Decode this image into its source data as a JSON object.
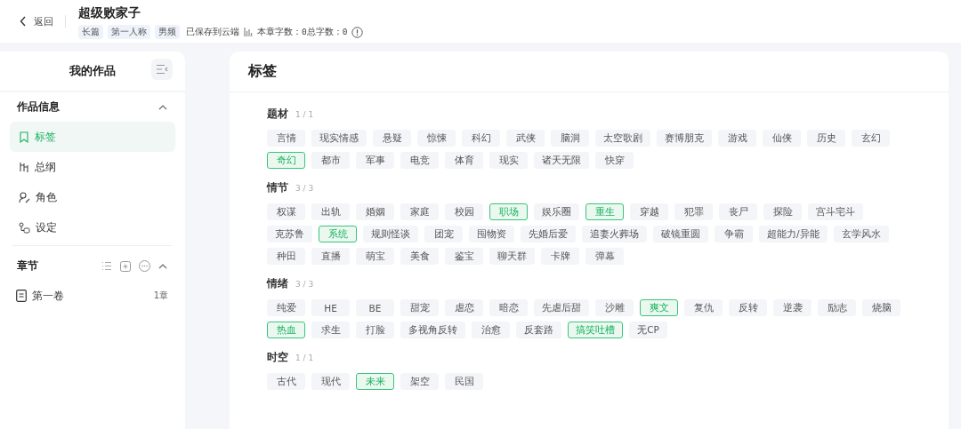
{
  "header": {
    "back_label": "返回",
    "title": "超级败家子",
    "chips": [
      "长篇",
      "第一人称",
      "男频"
    ],
    "save_status": "已保存到云端",
    "word_count": "本章字数：0总字数：0"
  },
  "sidebar": {
    "title": "我的作品",
    "sections": [
      {
        "title": "作品信息",
        "kind": "info",
        "expanded": true,
        "items": [
          {
            "label": "标签",
            "kind": "tag",
            "selected": true
          },
          {
            "label": "总纲",
            "kind": "outline",
            "selected": false
          },
          {
            "label": "角色",
            "kind": "character",
            "selected": false
          },
          {
            "label": "设定",
            "kind": "setting",
            "selected": false
          }
        ]
      },
      {
        "title": "章节",
        "kind": "chapters",
        "expanded": true,
        "items": [
          {
            "label": "第一卷",
            "kind": "volume",
            "selected": false,
            "count": "1章"
          }
        ]
      }
    ]
  },
  "main": {
    "title": "标签",
    "groups": [
      {
        "name": "题材",
        "count": "1 / 1",
        "tags": [
          {
            "label": "言情",
            "selected": false
          },
          {
            "label": "现实情感",
            "selected": false
          },
          {
            "label": "悬疑",
            "selected": false
          },
          {
            "label": "惊悚",
            "selected": false
          },
          {
            "label": "科幻",
            "selected": false
          },
          {
            "label": "武侠",
            "selected": false
          },
          {
            "label": "脑洞",
            "selected": false
          },
          {
            "label": "太空歌剧",
            "selected": false
          },
          {
            "label": "赛博朋克",
            "selected": false
          },
          {
            "label": "游戏",
            "selected": false
          },
          {
            "label": "仙侠",
            "selected": false
          },
          {
            "label": "历史",
            "selected": false
          },
          {
            "label": "玄幻",
            "selected": false
          },
          {
            "label": "奇幻",
            "selected": true
          },
          {
            "label": "都市",
            "selected": false
          },
          {
            "label": "军事",
            "selected": false
          },
          {
            "label": "电竞",
            "selected": false
          },
          {
            "label": "体育",
            "selected": false
          },
          {
            "label": "现实",
            "selected": false
          },
          {
            "label": "诸天无限",
            "selected": false
          },
          {
            "label": "快穿",
            "selected": false
          }
        ]
      },
      {
        "name": "情节",
        "count": "3 / 3",
        "tags": [
          {
            "label": "权谋",
            "selected": false
          },
          {
            "label": "出轨",
            "selected": false
          },
          {
            "label": "婚姻",
            "selected": false
          },
          {
            "label": "家庭",
            "selected": false
          },
          {
            "label": "校园",
            "selected": false
          },
          {
            "label": "职场",
            "selected": true
          },
          {
            "label": "娱乐圈",
            "selected": false
          },
          {
            "label": "重生",
            "selected": true
          },
          {
            "label": "穿越",
            "selected": false
          },
          {
            "label": "犯罪",
            "selected": false
          },
          {
            "label": "丧尸",
            "selected": false
          },
          {
            "label": "探险",
            "selected": false
          },
          {
            "label": "宫斗宅斗",
            "selected": false
          },
          {
            "label": "克苏鲁",
            "selected": false
          },
          {
            "label": "系统",
            "selected": true
          },
          {
            "label": "规则怪谈",
            "selected": false
          },
          {
            "label": "团宠",
            "selected": false
          },
          {
            "label": "囤物资",
            "selected": false
          },
          {
            "label": "先婚后爱",
            "selected": false
          },
          {
            "label": "追妻火葬场",
            "selected": false
          },
          {
            "label": "破镜重圆",
            "selected": false
          },
          {
            "label": "争霸",
            "selected": false
          },
          {
            "label": "超能力/异能",
            "selected": false
          },
          {
            "label": "玄学风水",
            "selected": false
          },
          {
            "label": "种田",
            "selected": false
          },
          {
            "label": "直播",
            "selected": false
          },
          {
            "label": "萌宝",
            "selected": false
          },
          {
            "label": "美食",
            "selected": false
          },
          {
            "label": "鉴宝",
            "selected": false
          },
          {
            "label": "聊天群",
            "selected": false
          },
          {
            "label": "卡牌",
            "selected": false
          },
          {
            "label": "弹幕",
            "selected": false
          }
        ]
      },
      {
        "name": "情绪",
        "count": "3 / 3",
        "tags": [
          {
            "label": "纯爱",
            "selected": false
          },
          {
            "label": "HE",
            "selected": false
          },
          {
            "label": "BE",
            "selected": false
          },
          {
            "label": "甜宠",
            "selected": false
          },
          {
            "label": "虐恋",
            "selected": false
          },
          {
            "label": "暗恋",
            "selected": false
          },
          {
            "label": "先虐后甜",
            "selected": false
          },
          {
            "label": "沙雕",
            "selected": false
          },
          {
            "label": "爽文",
            "selected": true
          },
          {
            "label": "复仇",
            "selected": false
          },
          {
            "label": "反转",
            "selected": false
          },
          {
            "label": "逆袭",
            "selected": false
          },
          {
            "label": "励志",
            "selected": false
          },
          {
            "label": "烧脑",
            "selected": false
          },
          {
            "label": "热血",
            "selected": true
          },
          {
            "label": "求生",
            "selected": false
          },
          {
            "label": "打脸",
            "selected": false
          },
          {
            "label": "多视角反转",
            "selected": false
          },
          {
            "label": "治愈",
            "selected": false
          },
          {
            "label": "反套路",
            "selected": false
          },
          {
            "label": "搞笑吐槽",
            "selected": true
          },
          {
            "label": "无CP",
            "selected": false
          }
        ]
      },
      {
        "name": "时空",
        "count": "1 / 1",
        "tags": [
          {
            "label": "古代",
            "selected": false
          },
          {
            "label": "现代",
            "selected": false
          },
          {
            "label": "未来",
            "selected": true
          },
          {
            "label": "架空",
            "selected": false
          },
          {
            "label": "民国",
            "selected": false
          }
        ]
      }
    ]
  }
}
